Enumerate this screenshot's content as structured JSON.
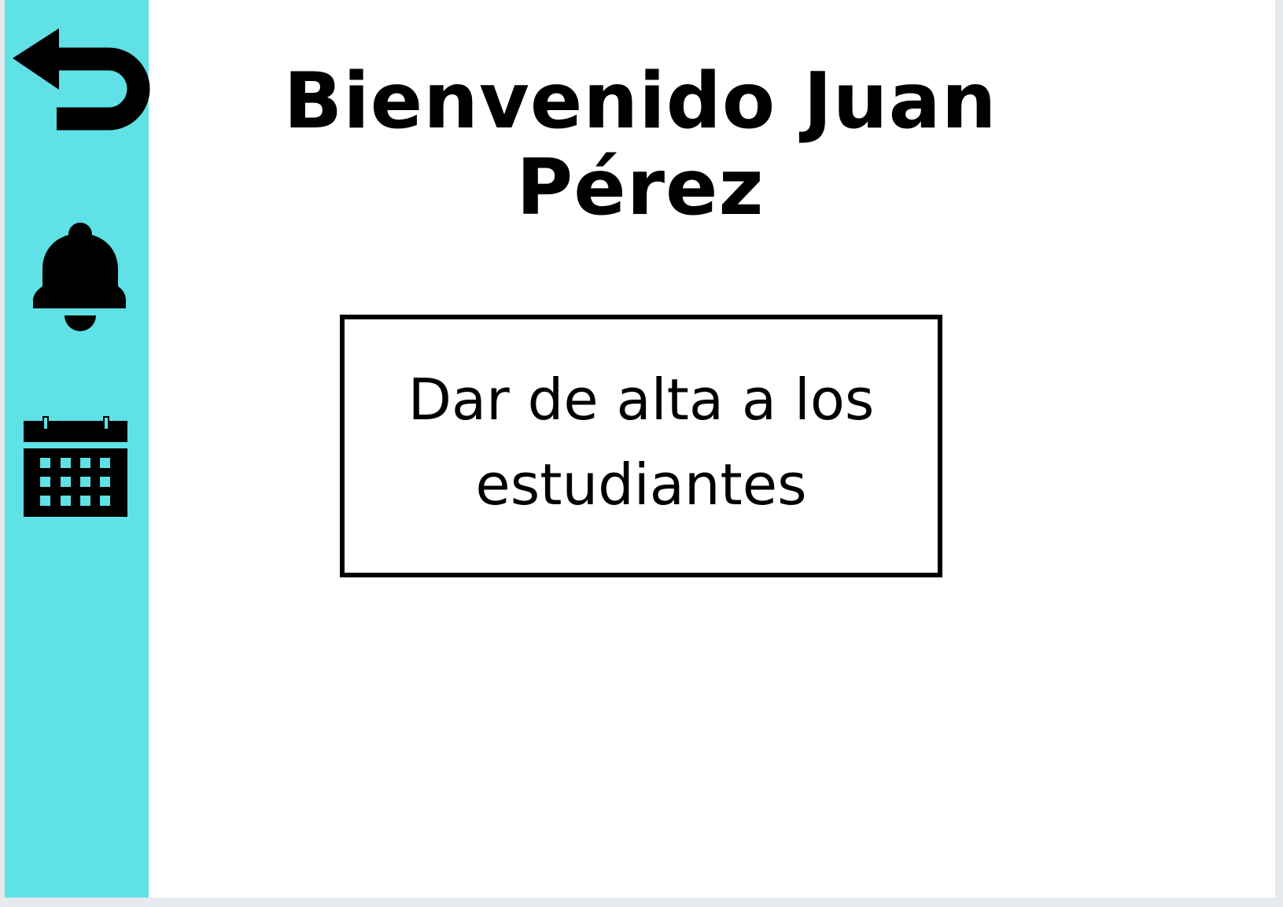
{
  "colors": {
    "sidebar": "#5fe1e6",
    "page_background": "#ffffff",
    "ink": "#000000"
  },
  "sidebar": {
    "items": [
      {
        "icon": "back-arrow-icon"
      },
      {
        "icon": "bell-icon"
      },
      {
        "icon": "calendar-icon"
      }
    ]
  },
  "main": {
    "title": "Bienvenido Juan Pérez",
    "action_label": "Dar de alta a los estudiantes"
  }
}
